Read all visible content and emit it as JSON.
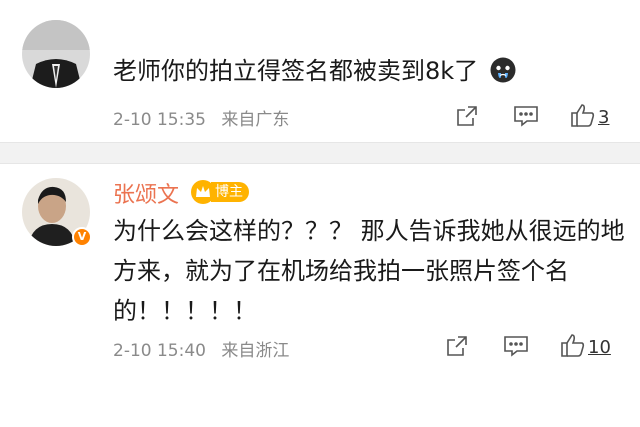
{
  "comments": [
    {
      "text": "老师你的拍立得签名都被卖到8k了",
      "time": "2-10 15:35",
      "source": "来自广东",
      "likes": "3",
      "emoji": "crying-face"
    },
    {
      "username": "张颂文",
      "badge": "博主",
      "text": "为什么会这样的？？？ 那人告诉我她从很远的地方来，就为了在机场给我拍一张照片签个名的！！！！！",
      "time": "2-10 15:40",
      "source": "来自浙江",
      "likes": "10"
    }
  ],
  "colors": {
    "username": "#eb7350",
    "badge": "#ffb300",
    "verified": "#ff8200",
    "meta": "#8a8a8a"
  }
}
